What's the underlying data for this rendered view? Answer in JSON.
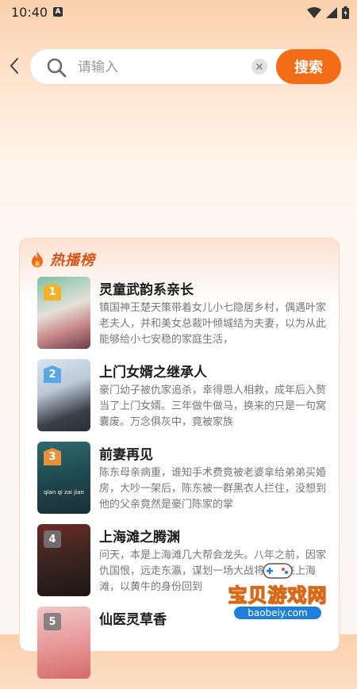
{
  "status_bar": {
    "time": "10:40",
    "notification_icon": "A"
  },
  "search": {
    "placeholder": "请输入",
    "value": "",
    "button_label": "搜索"
  },
  "hot_list": {
    "title": "热播榜",
    "items": [
      {
        "rank": "1",
        "title": "灵童武韵系亲长",
        "description": "镇国神王楚天策带着女儿小七隐居乡村，偶遇叶家老夫人，并和美女总裁叶倾城结为夫妻，以为从此能够给小七安稳的家庭生活，",
        "poster_text": ""
      },
      {
        "rank": "2",
        "title": "上门女婿之继承人",
        "description": "豪门幼子被仇家追杀，幸得恩人相救，成年后入赘当了上门女婿。三年做牛做马，换来的只是一句窝囊废。万念俱灰中，竟被家族",
        "poster_text": ""
      },
      {
        "rank": "3",
        "title": "前妻再见",
        "description": "陈东母亲病重，谁知手术费竟被老婆拿给弟弟买婚房，大吵一架后，陈东被一群黑衣人拦住，没想到他的父亲竟然是豪门陈家的掌",
        "poster_text": "qian qi zai jian"
      },
      {
        "rank": "4",
        "title": "上海滩之腾渊",
        "description": "问天，本是上海滩几大帮会龙头。八年之前，因家仇国恨，远走东瀛，谋划一场大战将，归来上海滩，以黄牛的身份回到",
        "poster_text": ""
      },
      {
        "rank": "5",
        "title": "仙医灵草香",
        "description": "",
        "poster_text": ""
      }
    ]
  },
  "watermark": {
    "text": "宝贝游戏网",
    "url": "baobeiy.com"
  },
  "colors": {
    "accent": "#f36d17",
    "hot_title": "#d9541a"
  }
}
